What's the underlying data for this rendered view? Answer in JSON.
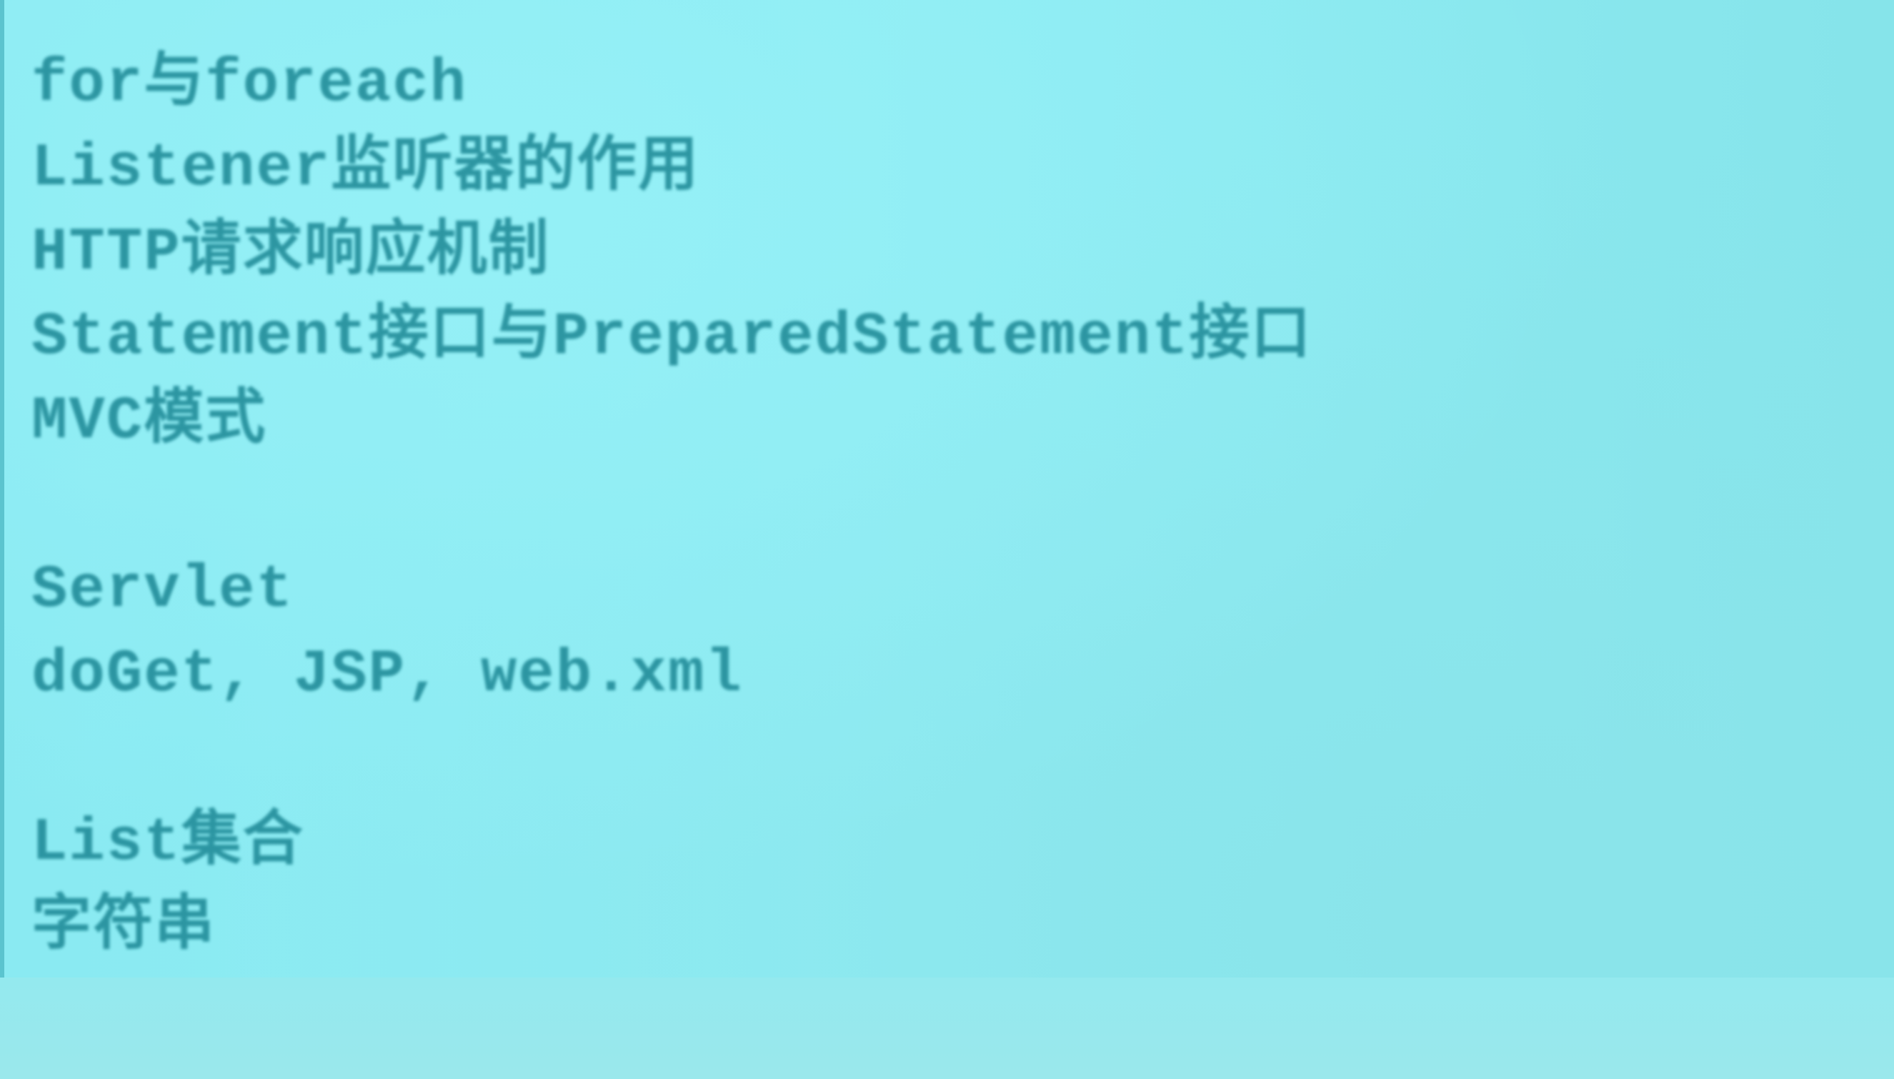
{
  "editor": {
    "lines": [
      "for与foreach",
      "Listener监听器的作用",
      "HTTP请求响应机制",
      "Statement接口与PreparedStatement接口",
      "MVC模式",
      "",
      "Servlet",
      "doGet, JSP, web.xml",
      "",
      "List集合",
      "字符串"
    ]
  },
  "colors": {
    "background": "#8aeaf2",
    "text": "#1f8a97"
  }
}
